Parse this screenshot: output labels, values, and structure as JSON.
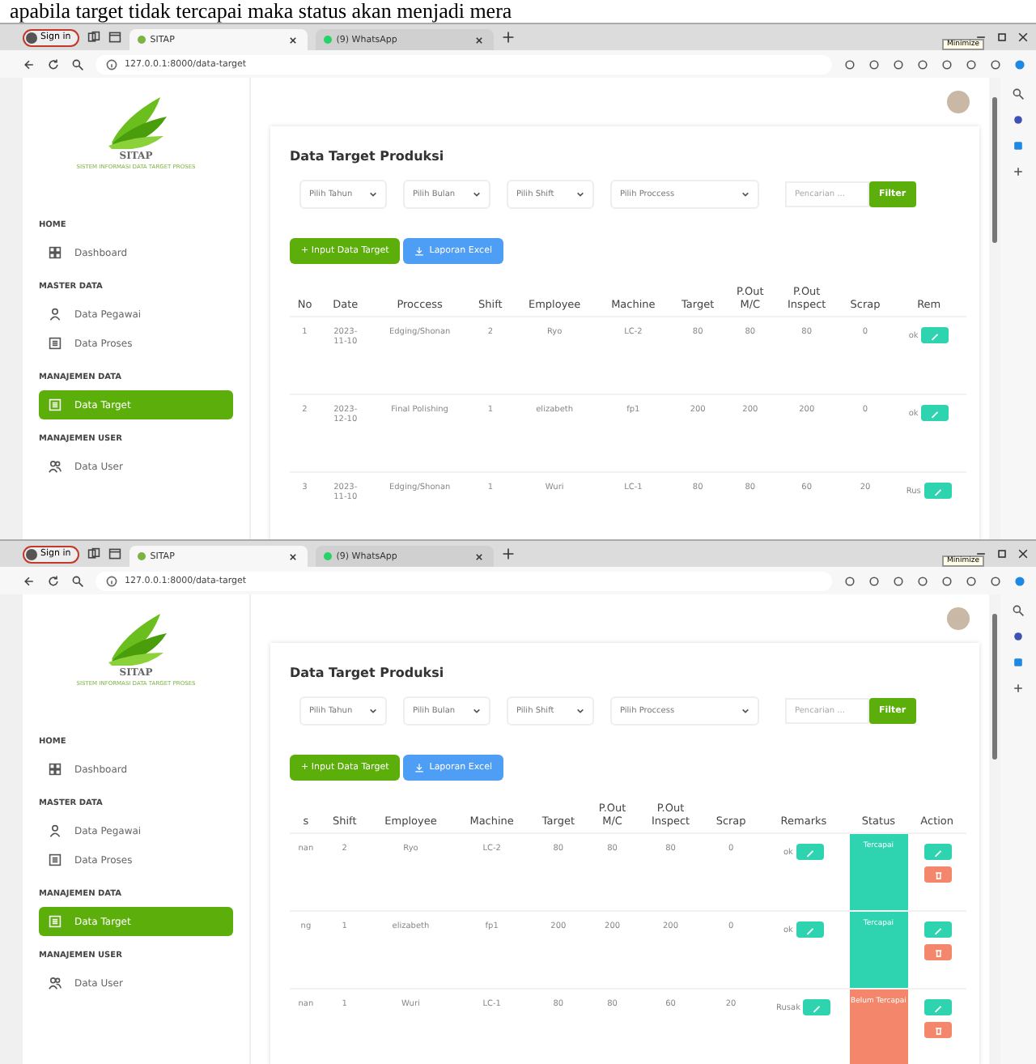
{
  "caption": "apabila target tidak tercapai maka status akan menjadi mera",
  "screens": [
    {
      "browser": {
        "profile": "Sign in",
        "tabs": [
          {
            "title": "SITAP",
            "selected": true
          },
          {
            "title": "(9) WhatsApp",
            "selected": false
          }
        ],
        "url": "127.0.0.1:8000/data-target",
        "tooltip": "Minimize"
      },
      "app": {
        "logo_title": "SITAP",
        "logo_subtitle": "SISTEM INFORMASI DATA TARGET PROSES",
        "nav": [
          {
            "heading": "HOME",
            "items": [
              {
                "label": "Dashboard",
                "kind": "dashboard",
                "selected": false
              }
            ]
          },
          {
            "heading": "MASTER DATA",
            "items": [
              {
                "label": "Data Pegawai",
                "kind": "person",
                "selected": false
              },
              {
                "label": "Data Proses",
                "kind": "list",
                "selected": false
              }
            ]
          },
          {
            "heading": "MANAJEMEN DATA",
            "items": [
              {
                "label": "Data Target",
                "kind": "list",
                "selected": true
              }
            ]
          },
          {
            "heading": "MANAJEMEN USER",
            "items": [
              {
                "label": "Data User",
                "kind": "users",
                "selected": false
              }
            ]
          }
        ],
        "title": "Data Target Produksi",
        "filters": [
          {
            "label": "Pilih Tahun",
            "kind": "short"
          },
          {
            "label": "Pilih Bulan",
            "kind": "short"
          },
          {
            "label": "Pilih Shift",
            "kind": "short"
          },
          {
            "label": "Pilih Proccess",
            "kind": "wide"
          }
        ],
        "search": {
          "placeholder": "Pencarian ..."
        },
        "filter_button": "Filter",
        "add_button": "+ Input Data Target",
        "export_button": "Laporan Excel",
        "columns": [
          {
            "label": "No",
            "kind": "text"
          },
          {
            "label": "Date",
            "kind": "date"
          },
          {
            "label": "Proccess",
            "kind": "text"
          },
          {
            "label": "Shift",
            "kind": "text"
          },
          {
            "label": "Employee",
            "kind": "text"
          },
          {
            "label": "Machine",
            "kind": "text"
          },
          {
            "label": "Target",
            "kind": "text"
          },
          {
            "label": "P.Out M/C",
            "kind": "text"
          },
          {
            "label": "P.Out Inspect",
            "kind": "text"
          },
          {
            "label": "Scrap",
            "kind": "text"
          },
          {
            "label": "Rem",
            "kind": "remarks"
          }
        ],
        "rows": [
          {
            "cells": [
              "1",
              "2023-11-10",
              "Edging/Shonan",
              "2",
              "Ryo",
              "LC-2",
              "80",
              "80",
              "80",
              "0",
              "ok"
            ]
          },
          {
            "cells": [
              "2",
              "2023-12-10",
              "Final Polishing",
              "1",
              "elizabeth",
              "fp1",
              "200",
              "200",
              "200",
              "0",
              "ok"
            ]
          },
          {
            "cells": [
              "3",
              "2023-11-10",
              "Edging/Shonan",
              "1",
              "Wuri",
              "LC-1",
              "80",
              "80",
              "60",
              "20",
              "Rus"
            ]
          }
        ]
      }
    },
    {
      "browser": {
        "profile": "Sign in",
        "tabs": [
          {
            "title": "SITAP",
            "selected": true
          },
          {
            "title": "(9) WhatsApp",
            "selected": false
          }
        ],
        "url": "127.0.0.1:8000/data-target",
        "tooltip": "Minimize"
      },
      "app": {
        "logo_title": "SITAP",
        "logo_subtitle": "SISTEM INFORMASI DATA TARGET PROSES",
        "nav": [
          {
            "heading": "HOME",
            "items": [
              {
                "label": "Dashboard",
                "kind": "dashboard",
                "selected": false
              }
            ]
          },
          {
            "heading": "MASTER DATA",
            "items": [
              {
                "label": "Data Pegawai",
                "kind": "person",
                "selected": false
              },
              {
                "label": "Data Proses",
                "kind": "list",
                "selected": false
              }
            ]
          },
          {
            "heading": "MANAJEMEN DATA",
            "items": [
              {
                "label": "Data Target",
                "kind": "list",
                "selected": true
              }
            ]
          },
          {
            "heading": "MANAJEMEN USER",
            "items": [
              {
                "label": "Data User",
                "kind": "users",
                "selected": false
              }
            ]
          }
        ],
        "title": "Data Target Produksi",
        "filters": [
          {
            "label": "Pilih Tahun",
            "kind": "short"
          },
          {
            "label": "Pilih Bulan",
            "kind": "short"
          },
          {
            "label": "Pilih Shift",
            "kind": "short"
          },
          {
            "label": "Pilih Proccess",
            "kind": "wide"
          }
        ],
        "search": {
          "placeholder": "Pencarian ..."
        },
        "filter_button": "Filter",
        "add_button": "+ Input Data Target",
        "export_button": "Laporan Excel",
        "columns": [
          {
            "label": "s",
            "kind": "text"
          },
          {
            "label": "Shift",
            "kind": "text"
          },
          {
            "label": "Employee",
            "kind": "text"
          },
          {
            "label": "Machine",
            "kind": "text"
          },
          {
            "label": "Target",
            "kind": "text"
          },
          {
            "label": "P.Out M/C",
            "kind": "text"
          },
          {
            "label": "P.Out Inspect",
            "kind": "text"
          },
          {
            "label": "Scrap",
            "kind": "text"
          },
          {
            "label": "Remarks",
            "kind": "remarks"
          },
          {
            "label": "Status",
            "kind": "status"
          },
          {
            "label": "Action",
            "kind": "action"
          }
        ],
        "rows": [
          {
            "cells": [
              "nan",
              "2",
              "Ryo",
              "LC-2",
              "80",
              "80",
              "80",
              "0",
              "ok"
            ],
            "status": {
              "label": "Tercapai",
              "color": "#2ed3b0"
            }
          },
          {
            "cells": [
              "ng",
              "1",
              "elizabeth",
              "fp1",
              "200",
              "200",
              "200",
              "0",
              "ok"
            ],
            "status": {
              "label": "Tercapai",
              "color": "#2ed3b0"
            }
          },
          {
            "cells": [
              "nan",
              "1",
              "Wuri",
              "LC-1",
              "80",
              "80",
              "60",
              "20",
              "Rusak"
            ],
            "status": {
              "label": "Belum Tercapai",
              "color": "#f4866b"
            }
          }
        ]
      }
    }
  ]
}
